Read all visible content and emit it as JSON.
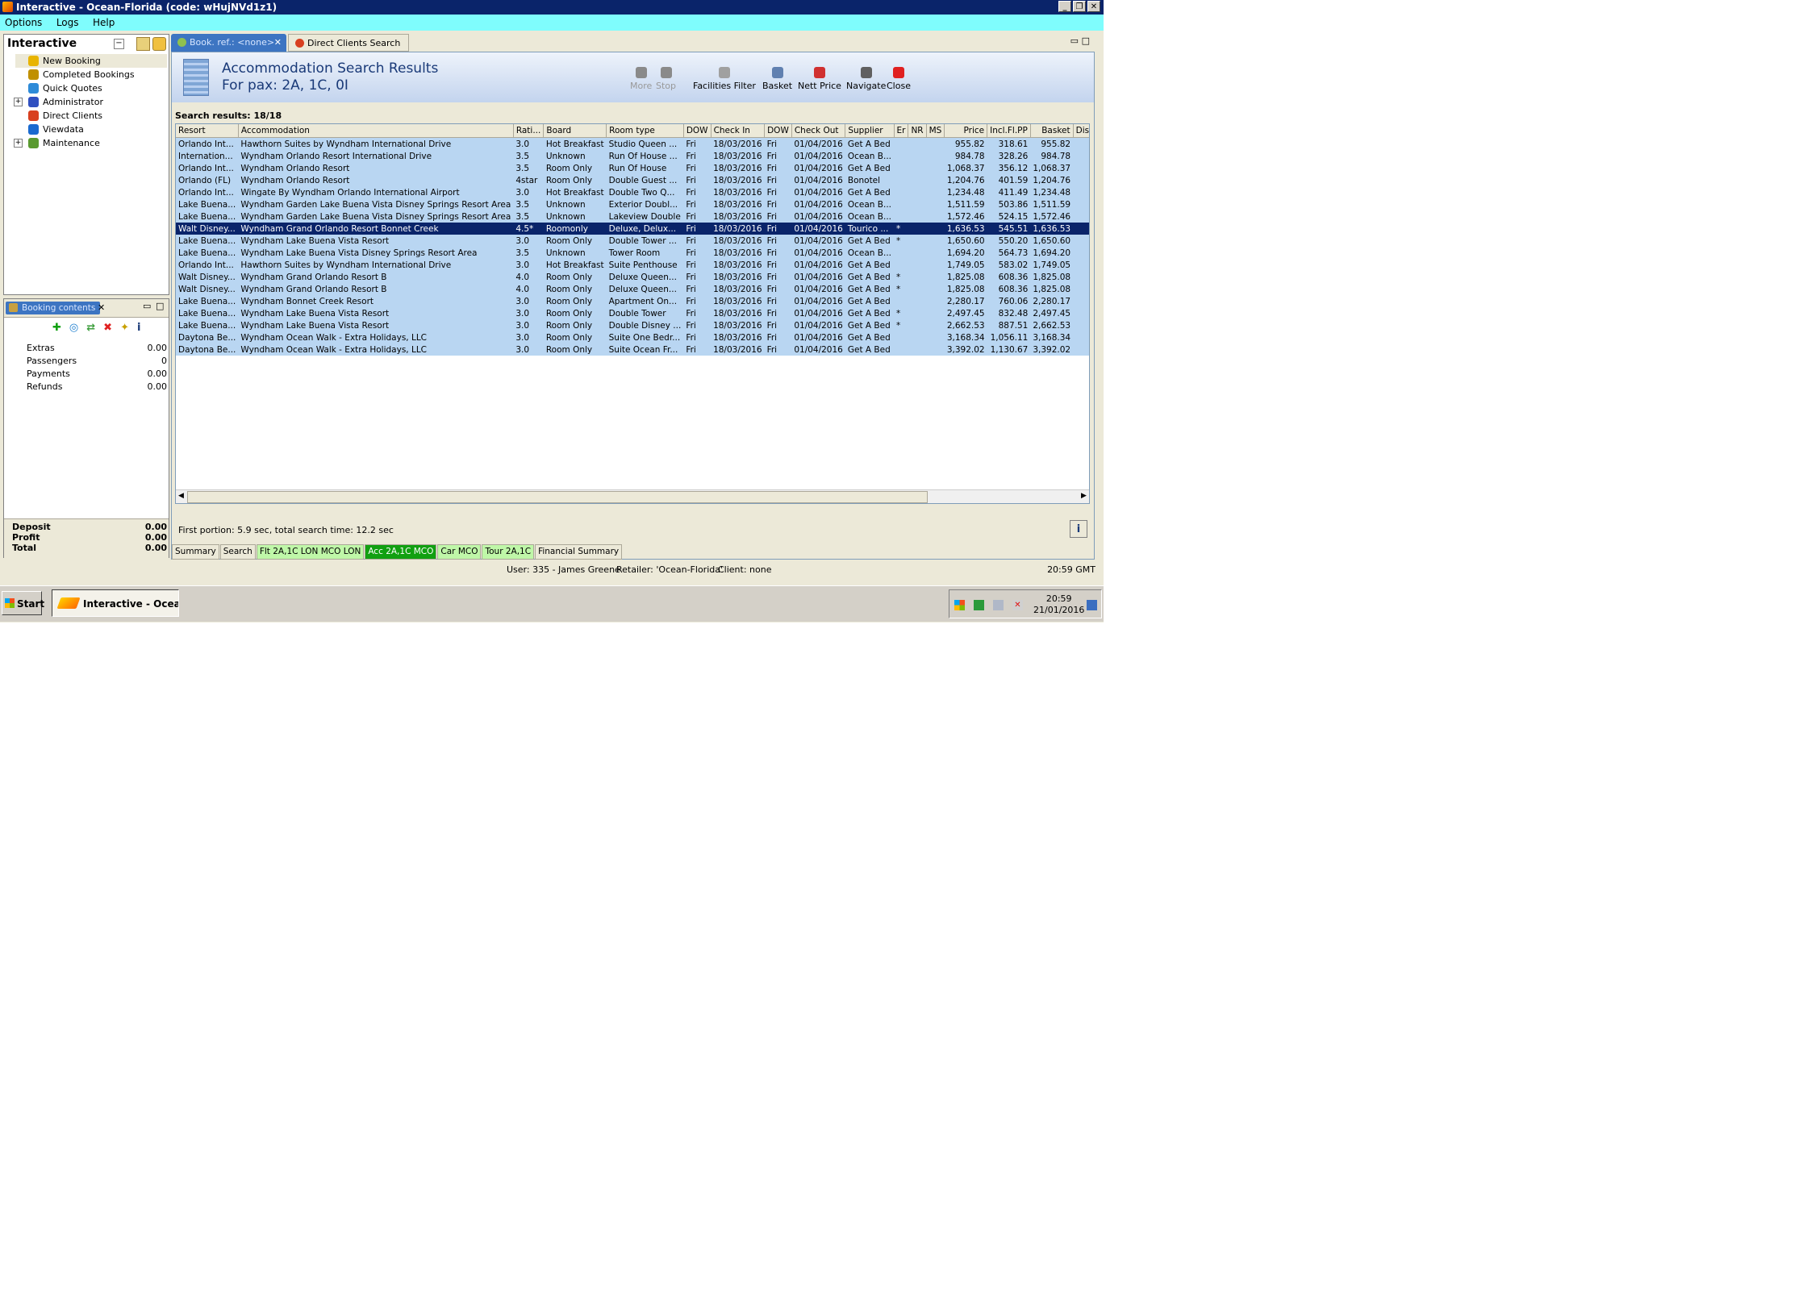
{
  "window": {
    "title": "Interactive - Ocean-Florida (code: wHujNVd1z1)"
  },
  "menu": [
    "Options",
    "Logs",
    "Help"
  ],
  "nav": {
    "title": "Interactive",
    "items": [
      {
        "label": "New Booking",
        "icon": "new-booking-icon",
        "color": "#e8b400"
      },
      {
        "label": "Completed Bookings",
        "icon": "completed-bookings-icon",
        "color": "#c09000"
      },
      {
        "label": "Quick Quotes",
        "icon": "quick-quotes-icon",
        "color": "#2e8bd8"
      },
      {
        "label": "Administrator",
        "icon": "administrator-icon",
        "color": "#3050c0",
        "expand": "+"
      },
      {
        "label": "Direct Clients",
        "icon": "direct-clients-icon",
        "color": "#d84020"
      },
      {
        "label": "Viewdata",
        "icon": "viewdata-icon",
        "color": "#1a6ad0"
      },
      {
        "label": "Maintenance",
        "icon": "maintenance-icon",
        "color": "#5a9a30",
        "expand": "+"
      }
    ]
  },
  "booking_contents": {
    "title": "Booking contents",
    "rows": [
      {
        "label": "Extras",
        "value": "0.00"
      },
      {
        "label": "Passengers",
        "value": "0"
      },
      {
        "label": "Payments",
        "value": "0.00"
      },
      {
        "label": "Refunds",
        "value": "0.00"
      }
    ],
    "totals": [
      {
        "label": "Deposit",
        "value": "0.00"
      },
      {
        "label": "Profit",
        "value": "0.00"
      },
      {
        "label": "Total",
        "value": "0.00"
      }
    ]
  },
  "tabs": [
    {
      "label": "Book. ref.: <none>",
      "close": "✕"
    },
    {
      "label": "Direct Clients Search"
    }
  ],
  "header": {
    "title": "Accommodation Search Results",
    "subtitle": "For pax: 2A, 1C, 0I"
  },
  "toolbar": [
    {
      "label": "More",
      "icon": "more-icon",
      "disabled": true
    },
    {
      "label": "Stop",
      "icon": "stop-icon",
      "disabled": true
    },
    {
      "label": "Facilities Filter",
      "icon": "filter-icon",
      "disabled": false
    },
    {
      "label": "Basket",
      "icon": "basket-icon",
      "disabled": false
    },
    {
      "label": "Nett Price",
      "icon": "nett-price-icon",
      "disabled": false
    },
    {
      "label": "Navigate",
      "icon": "navigate-icon",
      "disabled": false
    },
    {
      "label": "Close",
      "icon": "close-icon",
      "disabled": false
    }
  ],
  "results_label": "Search results: 18/18",
  "columns": [
    "Resort",
    "Accommodation",
    "Rati...",
    "Board",
    "Room type",
    "DOW",
    "Check In",
    "DOW",
    "Check Out",
    "Supplier",
    "Er",
    "NR",
    "MS",
    "Price",
    "Incl.Fl.PP",
    "Basket",
    "Dis"
  ],
  "rows": [
    [
      "Orlando Int...",
      "Hawthorn Suites by Wyndham International Drive",
      "3.0",
      "Hot Breakfast",
      "Studio Queen ...",
      "Fri",
      "18/03/2016",
      "Fri",
      "01/04/2016",
      "Get A Bed",
      "",
      "",
      "",
      "955.82",
      "318.61",
      "955.82",
      ""
    ],
    [
      "Internation...",
      "Wyndham Orlando Resort International Drive",
      "3.5",
      "Unknown",
      "Run Of House ...",
      "Fri",
      "18/03/2016",
      "Fri",
      "01/04/2016",
      "Ocean B...",
      "",
      "",
      "",
      "984.78",
      "328.26",
      "984.78",
      ""
    ],
    [
      "Orlando Int...",
      "Wyndham Orlando Resort",
      "3.5",
      "Room Only",
      "Run Of House",
      "Fri",
      "18/03/2016",
      "Fri",
      "01/04/2016",
      "Get A Bed",
      "",
      "",
      "",
      "1,068.37",
      "356.12",
      "1,068.37",
      ""
    ],
    [
      "Orlando (FL)",
      "Wyndham Orlando Resort",
      "4star",
      "Room Only",
      "Double Guest ...",
      "Fri",
      "18/03/2016",
      "Fri",
      "01/04/2016",
      "Bonotel",
      "",
      "",
      "",
      "1,204.76",
      "401.59",
      "1,204.76",
      ""
    ],
    [
      "Orlando Int...",
      "Wingate By Wyndham Orlando International Airport",
      "3.0",
      "Hot Breakfast",
      "Double Two Q...",
      "Fri",
      "18/03/2016",
      "Fri",
      "01/04/2016",
      "Get A Bed",
      "",
      "",
      "",
      "1,234.48",
      "411.49",
      "1,234.48",
      ""
    ],
    [
      "Lake Buena...",
      "Wyndham Garden Lake Buena Vista Disney Springs Resort Area",
      "3.5",
      "Unknown",
      "Exterior Doubl...",
      "Fri",
      "18/03/2016",
      "Fri",
      "01/04/2016",
      "Ocean B...",
      "",
      "",
      "",
      "1,511.59",
      "503.86",
      "1,511.59",
      ""
    ],
    [
      "Lake Buena...",
      "Wyndham Garden Lake Buena Vista Disney Springs Resort Area",
      "3.5",
      "Unknown",
      "Lakeview Double",
      "Fri",
      "18/03/2016",
      "Fri",
      "01/04/2016",
      "Ocean B...",
      "",
      "",
      "",
      "1,572.46",
      "524.15",
      "1,572.46",
      ""
    ],
    [
      "Walt Disney...",
      "Wyndham Grand Orlando Resort Bonnet Creek",
      "4.5*",
      "Roomonly",
      "Deluxe, Delux...",
      "Fri",
      "18/03/2016",
      "Fri",
      "01/04/2016",
      "Tourico ...",
      "*",
      "",
      "",
      "1,636.53",
      "545.51",
      "1,636.53",
      ""
    ],
    [
      "Lake Buena...",
      "Wyndham Lake Buena Vista Resort",
      "3.0",
      "Room Only",
      "Double Tower ...",
      "Fri",
      "18/03/2016",
      "Fri",
      "01/04/2016",
      "Get A Bed",
      "*",
      "",
      "",
      "1,650.60",
      "550.20",
      "1,650.60",
      ""
    ],
    [
      "Lake Buena...",
      "Wyndham Lake Buena Vista Disney Springs Resort Area",
      "3.5",
      "Unknown",
      "Tower Room",
      "Fri",
      "18/03/2016",
      "Fri",
      "01/04/2016",
      "Ocean B...",
      "",
      "",
      "",
      "1,694.20",
      "564.73",
      "1,694.20",
      ""
    ],
    [
      "Orlando Int...",
      "Hawthorn Suites by Wyndham International Drive",
      "3.0",
      "Hot Breakfast",
      "Suite Penthouse",
      "Fri",
      "18/03/2016",
      "Fri",
      "01/04/2016",
      "Get A Bed",
      "",
      "",
      "",
      "1,749.05",
      "583.02",
      "1,749.05",
      ""
    ],
    [
      "Walt Disney...",
      "Wyndham Grand Orlando Resort B",
      "4.0",
      "Room Only",
      "Deluxe Queen...",
      "Fri",
      "18/03/2016",
      "Fri",
      "01/04/2016",
      "Get A Bed",
      "*",
      "",
      "",
      "1,825.08",
      "608.36",
      "1,825.08",
      ""
    ],
    [
      "Walt Disney...",
      "Wyndham Grand Orlando Resort B",
      "4.0",
      "Room Only",
      "Deluxe Queen...",
      "Fri",
      "18/03/2016",
      "Fri",
      "01/04/2016",
      "Get A Bed",
      "*",
      "",
      "",
      "1,825.08",
      "608.36",
      "1,825.08",
      ""
    ],
    [
      "Lake Buena...",
      "Wyndham Bonnet Creek Resort",
      "3.0",
      "Room Only",
      "Apartment On...",
      "Fri",
      "18/03/2016",
      "Fri",
      "01/04/2016",
      "Get A Bed",
      "",
      "",
      "",
      "2,280.17",
      "760.06",
      "2,280.17",
      ""
    ],
    [
      "Lake Buena...",
      "Wyndham Lake Buena Vista Resort",
      "3.0",
      "Room Only",
      "Double Tower",
      "Fri",
      "18/03/2016",
      "Fri",
      "01/04/2016",
      "Get A Bed",
      "*",
      "",
      "",
      "2,497.45",
      "832.48",
      "2,497.45",
      ""
    ],
    [
      "Lake Buena...",
      "Wyndham Lake Buena Vista Resort",
      "3.0",
      "Room Only",
      "Double Disney ...",
      "Fri",
      "18/03/2016",
      "Fri",
      "01/04/2016",
      "Get A Bed",
      "*",
      "",
      "",
      "2,662.53",
      "887.51",
      "2,662.53",
      ""
    ],
    [
      "Daytona Be...",
      "Wyndham Ocean Walk - Extra Holidays, LLC",
      "3.0",
      "Room Only",
      "Suite One Bedr...",
      "Fri",
      "18/03/2016",
      "Fri",
      "01/04/2016",
      "Get A Bed",
      "",
      "",
      "",
      "3,168.34",
      "1,056.11",
      "3,168.34",
      ""
    ],
    [
      "Daytona Be...",
      "Wyndham Ocean Walk - Extra Holidays, LLC",
      "3.0",
      "Room Only",
      "Suite Ocean Fr...",
      "Fri",
      "18/03/2016",
      "Fri",
      "01/04/2016",
      "Get A Bed",
      "",
      "",
      "",
      "3,392.02",
      "1,130.67",
      "3,392.02",
      ""
    ]
  ],
  "selected_row": 7,
  "status_text": "First portion: 5.9 sec, total search time: 12.2 sec",
  "info_button": "i",
  "bottom_tabs": [
    {
      "label": "Summary",
      "style": "plain"
    },
    {
      "label": "Search",
      "style": "plain"
    },
    {
      "label": "Flt 2A,1C LON MCO LON",
      "style": "light-green"
    },
    {
      "label": "Acc 2A,1C MCO",
      "style": "dark-green"
    },
    {
      "label": "Car MCO",
      "style": "light-green"
    },
    {
      "label": "Tour 2A,1C",
      "style": "light-green"
    },
    {
      "label": "Financial Summary",
      "style": "plain"
    }
  ],
  "user_bar": {
    "user": "User: 335 - James Greene",
    "retailer": "Retailer: 'Ocean-Florida'",
    "client": "Client: none",
    "time": "20:59 GMT"
  },
  "taskbar": {
    "start": "Start",
    "task": "Interactive - Ocea...",
    "clock_time": "20:59",
    "clock_date": "21/01/2016"
  },
  "colors": {
    "title_bar": "#0a246a",
    "menu_bar": "#7ffdfd",
    "row": "#b9d6f2",
    "selected_row": "#0a246a",
    "active_tab": "#3d75c2"
  }
}
